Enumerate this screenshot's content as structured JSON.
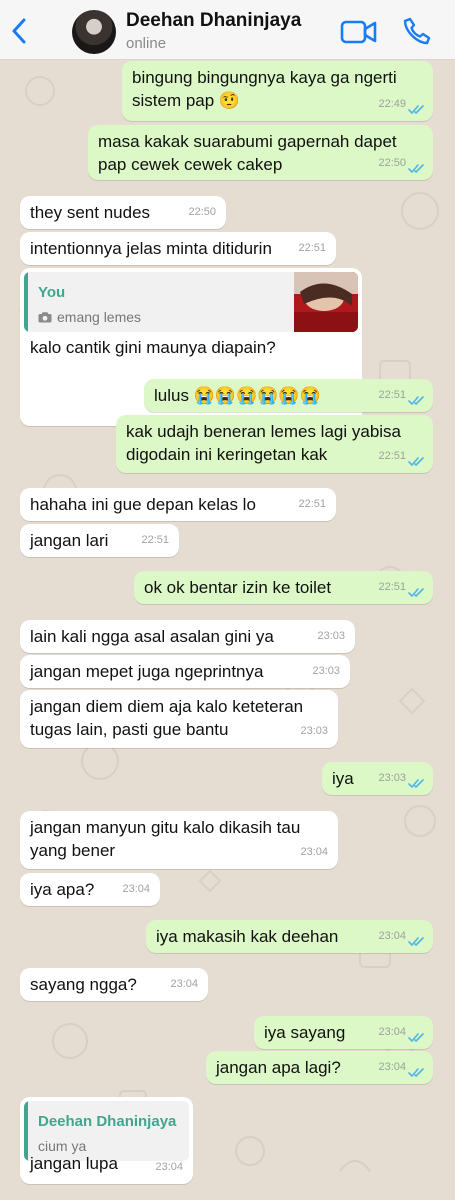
{
  "header": {
    "contact_name": "Deehan Dhaninjaya",
    "status": "online",
    "accent_color": "#1a7cf5",
    "back_icon": "chevron-left-icon",
    "video_icon": "video-camera-icon",
    "call_icon": "phone-icon"
  },
  "colors": {
    "outgoing_bubble": "#dcf8c6",
    "incoming_bubble": "#ffffff",
    "read_ticks": "#4fb6ec",
    "quote_accent": "#3fa78f",
    "chat_background": "#e6ddd2"
  },
  "messages": [
    {
      "dir": "out",
      "lines": [
        "bingung bingungnya kaya ga ngerti",
        "sistem pap 🤨"
      ],
      "time": "22:49",
      "read": true
    },
    {
      "dir": "out",
      "lines": [
        "masa kakak suarabumi gapernah dapet",
        "pap cewek cewek cakep"
      ],
      "time": "22:50",
      "read": true
    },
    {
      "dir": "in",
      "lines": [
        "they sent nudes"
      ],
      "time": "22:50"
    },
    {
      "dir": "in",
      "lines": [
        "intentionnya jelas minta ditidurin"
      ],
      "time": "22:51"
    },
    {
      "dir": "in",
      "lines": [
        "kalo cantik gini maunya diapain?"
      ],
      "time": "22:51",
      "quote": {
        "author": "You",
        "text": "emang lemes",
        "icon": "camera-icon"
      }
    },
    {
      "dir": "out",
      "lines": [
        "lulus 😭😭😭😭😭😭"
      ],
      "time": "22:51",
      "read": true
    },
    {
      "dir": "out",
      "lines": [
        "kak udajh beneran lemes lagi yabisa",
        "digodain ini keringetan kak"
      ],
      "time": "22:51",
      "read": true
    },
    {
      "dir": "in",
      "lines": [
        "hahaha ini gue depan kelas lo"
      ],
      "time": "22:51"
    },
    {
      "dir": "in",
      "lines": [
        "jangan lari"
      ],
      "time": "22:51"
    },
    {
      "dir": "out",
      "lines": [
        "ok ok bentar izin ke toilet"
      ],
      "time": "22:51",
      "read": true
    },
    {
      "dir": "in",
      "lines": [
        "lain kali ngga asal asalan gini ya"
      ],
      "time": "23:03"
    },
    {
      "dir": "in",
      "lines": [
        "jangan mepet juga ngeprintnya"
      ],
      "time": "23:03"
    },
    {
      "dir": "in",
      "lines": [
        "jangan diem diem aja kalo keteteran",
        "tugas lain, pasti gue bantu"
      ],
      "time": "23:03"
    },
    {
      "dir": "out",
      "lines": [
        "iya"
      ],
      "time": "23:03",
      "read": true
    },
    {
      "dir": "in",
      "lines": [
        "jangan manyun gitu kalo dikasih tau",
        "yang bener"
      ],
      "time": "23:04"
    },
    {
      "dir": "in",
      "lines": [
        "iya apa?"
      ],
      "time": "23:04"
    },
    {
      "dir": "out",
      "lines": [
        "iya makasih kak deehan"
      ],
      "time": "23:04",
      "read": true
    },
    {
      "dir": "in",
      "lines": [
        "sayang ngga?"
      ],
      "time": "23:04"
    },
    {
      "dir": "out",
      "lines": [
        "iya sayang"
      ],
      "time": "23:04",
      "read": true
    },
    {
      "dir": "out",
      "lines": [
        "jangan apa lagi?"
      ],
      "time": "23:04",
      "read": true
    },
    {
      "dir": "in",
      "lines": [
        "jangan lupa"
      ],
      "time": "23:04",
      "quote": {
        "author": "Deehan Dhaninjaya",
        "text": "cium ya"
      }
    }
  ]
}
